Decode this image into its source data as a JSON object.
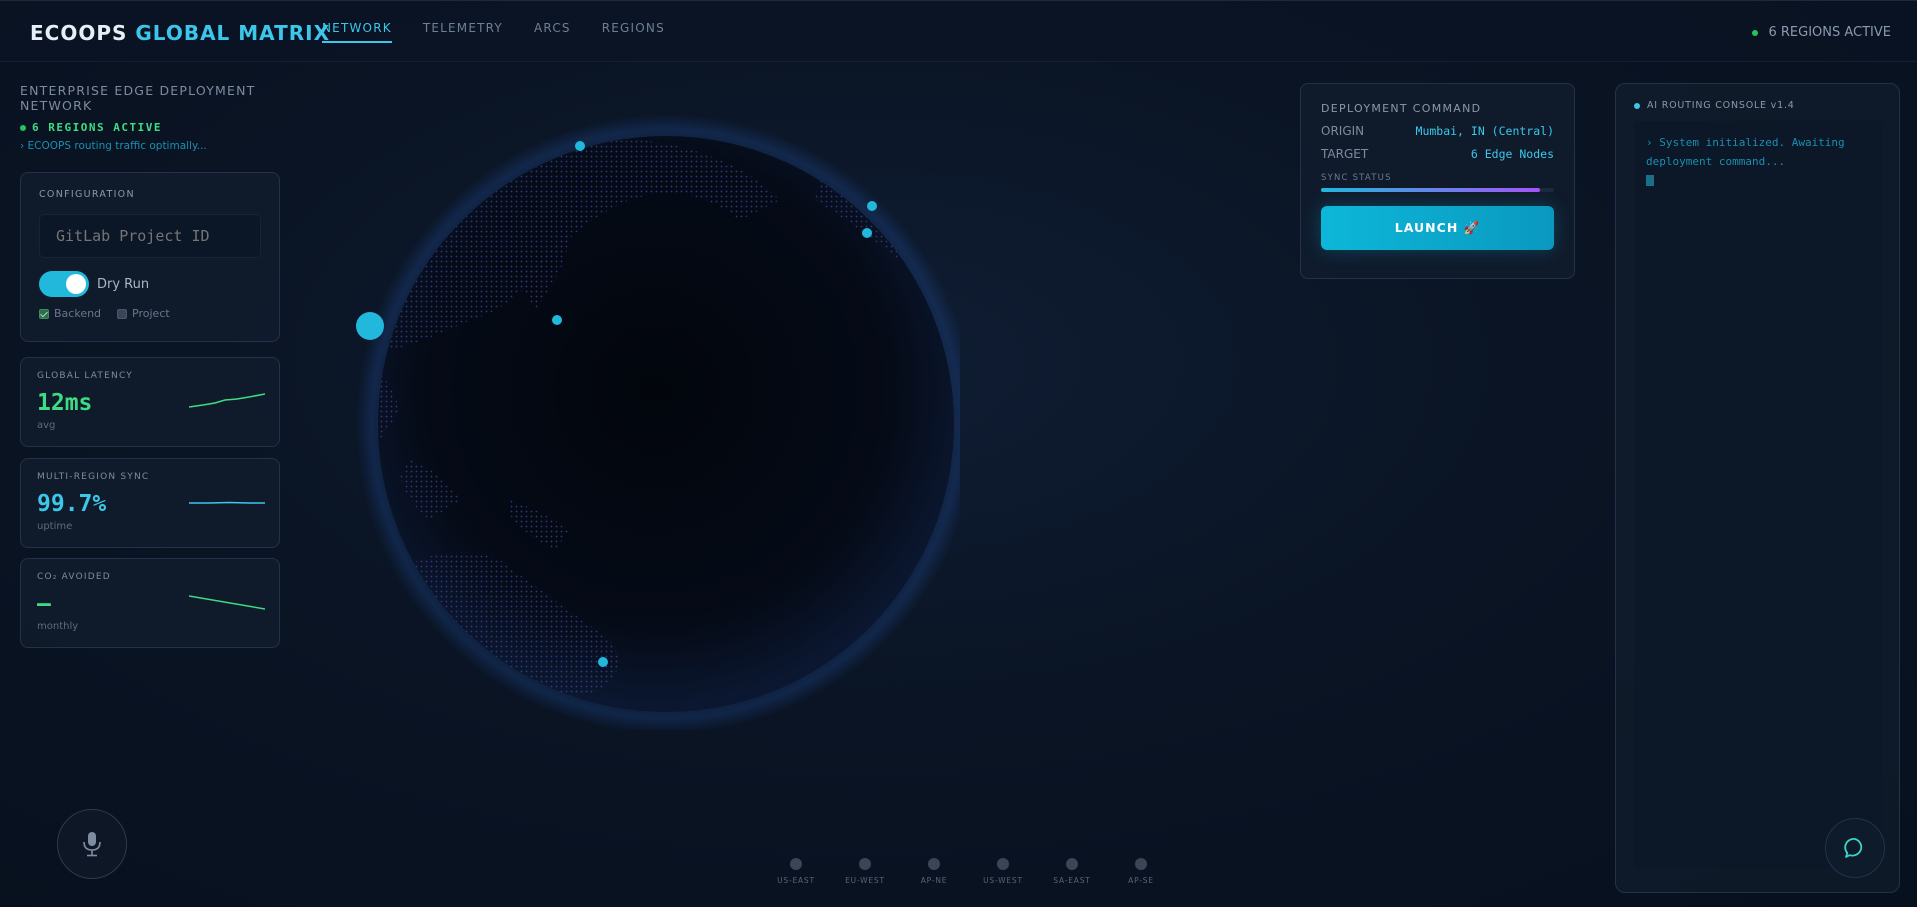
{
  "brand": {
    "part1": "ECOOPS",
    "part2": "GLOBAL MATRIX"
  },
  "nav": {
    "tabs": [
      {
        "label": "NETWORK",
        "active": true
      },
      {
        "label": "TELEMETRY",
        "active": false
      },
      {
        "label": "ARCS",
        "active": false
      },
      {
        "label": "REGIONS",
        "active": false
      }
    ]
  },
  "top_status": "6 REGIONS ACTIVE",
  "network": {
    "title": "ENTERPRISE EDGE DEPLOYMENT NETWORK",
    "active": "6 REGIONS ACTIVE",
    "routing": "› ECOOPS routing traffic optimally..."
  },
  "config": {
    "label": "CONFIGURATION",
    "input_placeholder": "GitLab Project ID",
    "input_value": "",
    "dry_run_label": "Dry Run",
    "dry_run_on": true,
    "checks": [
      {
        "label": "Backend",
        "checked": true
      },
      {
        "label": "Project",
        "checked": false
      }
    ]
  },
  "metrics": [
    {
      "label": "GLOBAL LATENCY",
      "value": "12ms",
      "sub": "avg"
    },
    {
      "label": "MULTI-REGION SYNC",
      "value": "99.7%",
      "sub": "uptime"
    },
    {
      "label": "CO₂ AVOIDED",
      "value": "—",
      "sub": "monthly"
    }
  ],
  "deploy": {
    "title": "DEPLOYMENT COMMAND",
    "origin_label": "ORIGIN",
    "origin_value": "Mumbai, IN (Central)",
    "target_label": "TARGET",
    "target_value": "6 Edge Nodes",
    "sync_label": "SYNC STATUS",
    "sync_progress": 0.94,
    "launch_label": "LAUNCH 🚀"
  },
  "console": {
    "title": "AI ROUTING CONSOLE v1.4",
    "lines": [
      "› System initialized. Awaiting deployment command..."
    ]
  },
  "regions": [
    "US-EAST",
    "EU-WEST",
    "AP-NE",
    "US-WEST",
    "SA-EAST",
    "AP-SE"
  ],
  "colors": {
    "accent": "#3cc7ea",
    "success": "#3ddc84",
    "purple": "#a855f7",
    "bg": "#0a1424"
  },
  "icons": {
    "mic": "microphone-icon",
    "chat": "chat-bubble-icon"
  }
}
